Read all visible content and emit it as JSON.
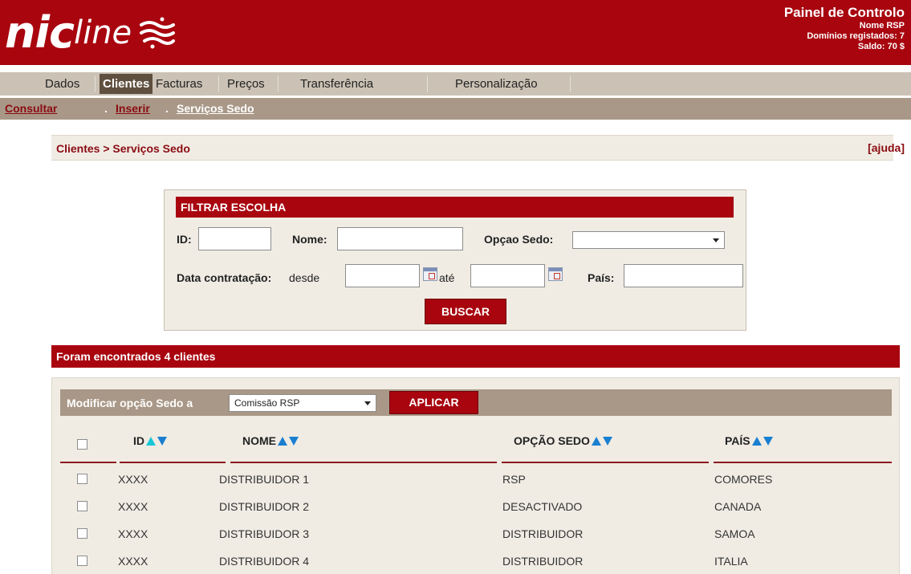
{
  "header": {
    "logo_nic": "nic",
    "logo_line": "line",
    "title": "Painel de Controlo",
    "user_name": "Nome RSP",
    "domains": "Domínios registados: 7",
    "balance": "Saldo: 70 $"
  },
  "nav": {
    "items": [
      "Dados",
      "Clientes",
      "Facturas",
      "Preços",
      "Transferência",
      "Personalização"
    ],
    "active": "Clientes"
  },
  "subnav": {
    "items": [
      "Consultar",
      "Inserir",
      "Serviços Sedo"
    ],
    "separator": "."
  },
  "breadcrumb": "Clientes > Serviços Sedo",
  "help": "[ajuda]",
  "filter": {
    "title": "FILTRAR ESCOLHA",
    "id_label": "ID:",
    "name_label": "Nome:",
    "sedo_label": "Opçao Sedo:",
    "date_label": "Data contratação:",
    "from_label": "desde",
    "to_label": "até",
    "country_label": "País:",
    "search_button": "BUSCAR"
  },
  "results": {
    "found_text": "Foram encontrados 4 clientes",
    "modify_label": "Modificar opção Sedo a",
    "modify_selected": "Comissão RSP",
    "apply_button": "APLICAR",
    "columns": [
      "ID",
      "NOME",
      "OPÇÃO SEDO",
      "PAÍS"
    ],
    "rows": [
      [
        "XXXX",
        "DISTRIBUIDOR 1",
        "RSP",
        "COMORES"
      ],
      [
        "XXXX",
        "DISTRIBUIDOR 2",
        "DESACTIVADO",
        "CANADA"
      ],
      [
        "XXXX",
        "DISTRIBUIDOR 3",
        "DISTRIBUIDOR",
        "SAMOA"
      ],
      [
        "XXXX",
        "DISTRIBUIDOR 4",
        "DISTRIBUIDOR",
        "ITALIA"
      ]
    ]
  },
  "colors": {
    "brand_red": "#a8050f",
    "nav_bg": "#cbc2b5",
    "nav_active": "#5f4f3e",
    "subnav_bg": "#a99887",
    "panel_bg": "#f0ece4",
    "sort_arrow": "#1a7fd0"
  }
}
